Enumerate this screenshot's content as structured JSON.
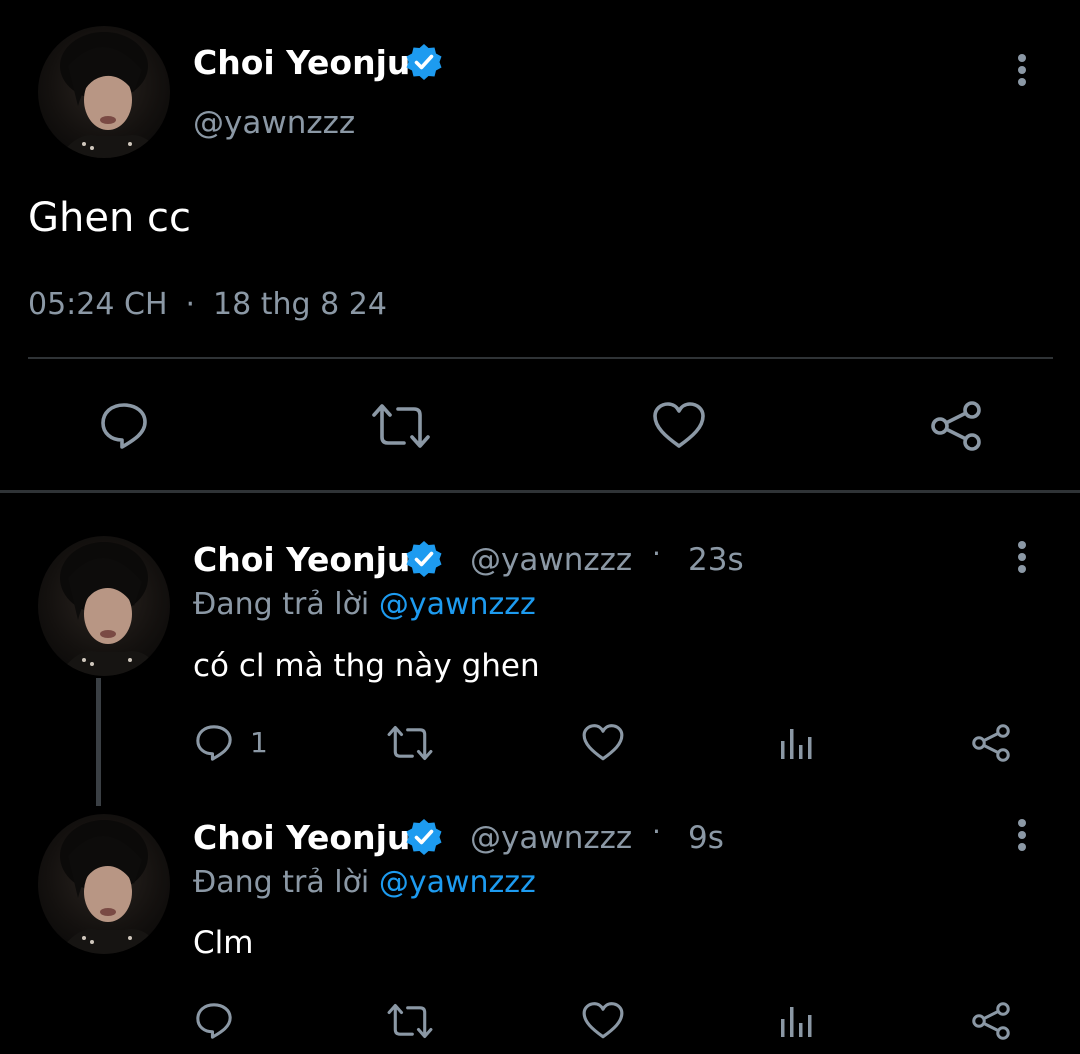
{
  "main_tweet": {
    "author_name": "Choi Yeonjun",
    "handle": "@yawnzzz",
    "text": "Ghen cc",
    "time": "05:24 CH",
    "separator": "·",
    "date": "18 thg 8 24"
  },
  "replies": [
    {
      "author_name": "Choi Yeonjun",
      "handle": "@yawnzzz",
      "separator": "·",
      "age": "23s",
      "reply_prefix": "Đang trả lời",
      "reply_mention": "@yawnzzz",
      "text": "có cl mà thg này ghen",
      "reply_count": "1"
    },
    {
      "author_name": "Choi Yeonjun",
      "handle": "@yawnzzz",
      "separator": "·",
      "age": "9s",
      "reply_prefix": "Đang trả lời",
      "reply_mention": "@yawnzzz",
      "text": "Clm",
      "reply_count": ""
    }
  ],
  "icons": {
    "reply": "speech-bubble-icon",
    "retweet": "retweet-arrows-icon",
    "like": "heart-icon",
    "views": "bar-chart-icon",
    "share": "share-nodes-icon",
    "more": "vertical-dots-icon",
    "verified": "verified-badge-icon"
  },
  "colors": {
    "background": "#000000",
    "accent_blue": "#1d9bf0",
    "muted_text": "#8b98a5",
    "divider": "#2f3336"
  }
}
